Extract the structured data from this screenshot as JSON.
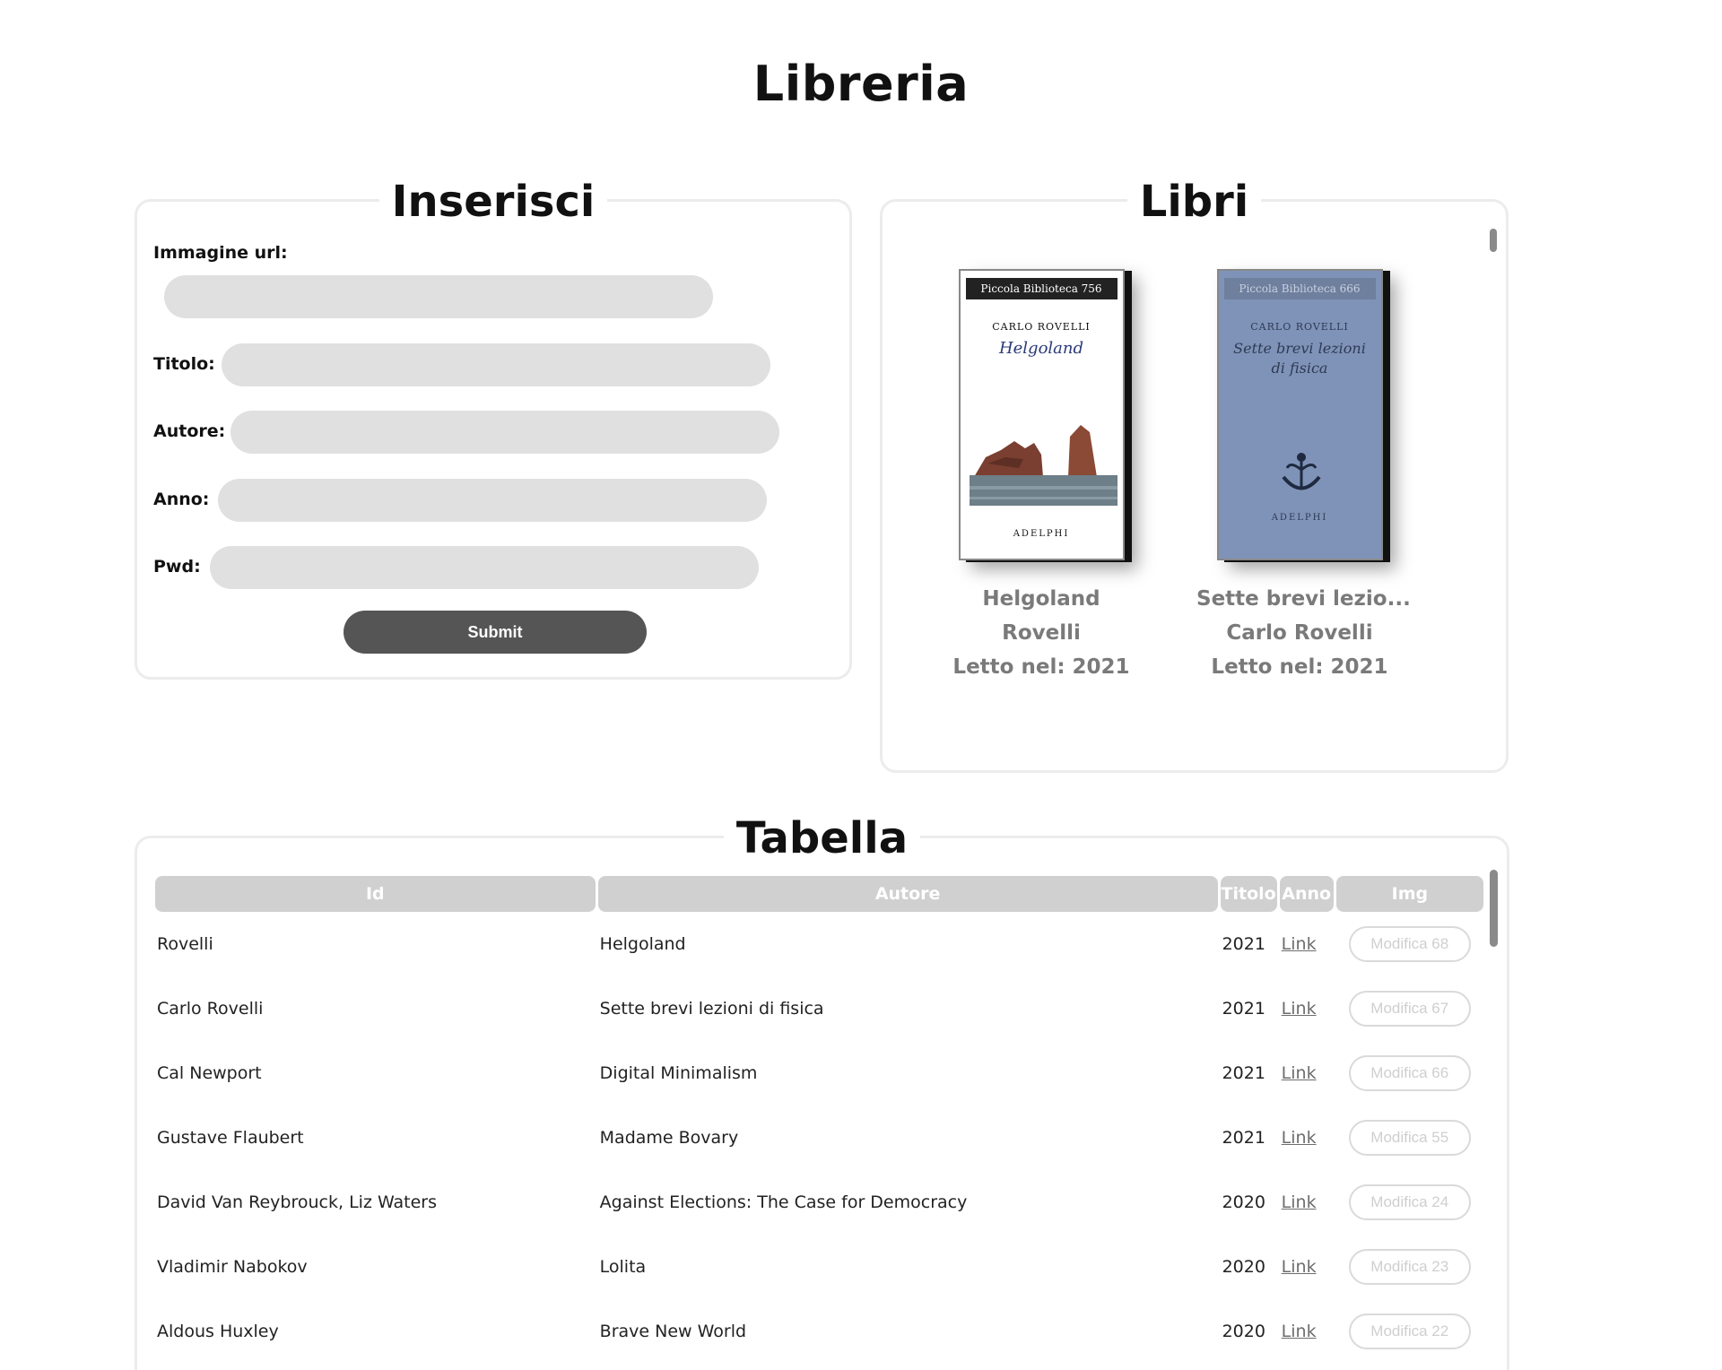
{
  "page": {
    "title": "Libreria"
  },
  "form": {
    "title": "Inserisci",
    "image_url_label": "Immagine url:",
    "title_label": "Titolo:",
    "author_label": "Autore:",
    "year_label": "Anno:",
    "pwd_label": "Pwd:",
    "submit_label": "Submit"
  },
  "books_panel": {
    "title": "Libri",
    "books": [
      {
        "title": "Helgoland",
        "author": "Rovelli",
        "read": "Letto nel: 2021",
        "cover": {
          "series": "Piccola Biblioteca 756",
          "author": "CARLO ROVELLI",
          "title": "Helgoland",
          "publisher": "ADELPHI",
          "color": "#ffffff"
        }
      },
      {
        "title": "Sette brevi lezio...",
        "author": "Carlo Rovelli",
        "read": "Letto nel: 2021",
        "cover": {
          "series": "Piccola Biblioteca 666",
          "author": "CARLO ROVELLI",
          "title": "Sette brevi lezioni di fisica",
          "publisher": "ADELPHI",
          "color": "#7f93b8"
        }
      }
    ]
  },
  "table_panel": {
    "title": "Tabella",
    "headers": [
      "Id",
      "Autore",
      "Titolo",
      "Anno",
      "Img"
    ],
    "rows": [
      {
        "author": "Rovelli",
        "title": "Helgoland",
        "year": "2021",
        "link": "Link",
        "edit": "Modifica 68"
      },
      {
        "author": "Carlo Rovelli",
        "title": "Sette brevi lezioni di fisica",
        "year": "2021",
        "link": "Link",
        "edit": "Modifica 67"
      },
      {
        "author": "Cal Newport",
        "title": "Digital Minimalism",
        "year": "2021",
        "link": "Link",
        "edit": "Modifica 66"
      },
      {
        "author": "Gustave Flaubert",
        "title": "Madame Bovary",
        "year": "2021",
        "link": "Link",
        "edit": "Modifica 55"
      },
      {
        "author": "David Van Reybrouck, Liz Waters",
        "title": "Against Elections: The Case for Democracy",
        "year": "2020",
        "link": "Link",
        "edit": "Modifica 24"
      },
      {
        "author": "Vladimir Nabokov",
        "title": "Lolita",
        "year": "2020",
        "link": "Link",
        "edit": "Modifica 23"
      },
      {
        "author": "Aldous Huxley",
        "title": "Brave New World",
        "year": "2020",
        "link": "Link",
        "edit": "Modifica 22"
      }
    ]
  }
}
